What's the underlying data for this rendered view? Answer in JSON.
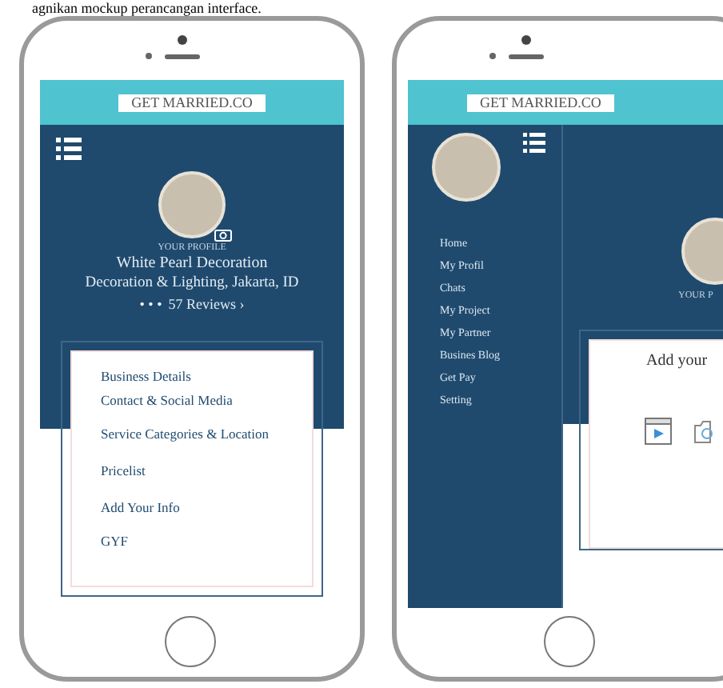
{
  "caption_fragment": "agnikan mockup perancangan interface.",
  "profile_screen": {
    "brand": "GET MARRIED.CO",
    "profile_label": "YOUR PROFILE",
    "business_name": "White Pearl Decoration",
    "business_info": "Decoration & Lighting, Jakarta, ID",
    "rating": "• • •",
    "reviews": "57 Reviews ›",
    "menu": [
      "Business Details",
      "Contact & Social Media",
      "Service Categories & Location",
      "Pricelist",
      "Add Your Info",
      "GYF"
    ]
  },
  "sidebar_screen": {
    "brand": "GET MARRIED.CO",
    "sidebar_items": [
      "Home",
      "My Profil",
      "Chats",
      "My Project",
      "My Partner",
      "Busines Blog",
      "Get Pay",
      "Setting"
    ],
    "profile_label": "YOUR P",
    "card_title": "Add your"
  }
}
